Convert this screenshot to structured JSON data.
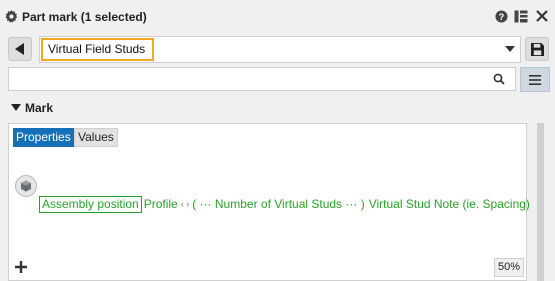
{
  "titlebar": {
    "title": "Part mark (1 selected)",
    "icons": [
      "gear-icon",
      "help-icon",
      "layout-toggle-icon",
      "close-icon"
    ]
  },
  "preset": {
    "value": "Virtual Field Studs",
    "highlight_color": "#f5a623"
  },
  "search": {
    "placeholder": ""
  },
  "mark_section": {
    "heading": "Mark",
    "tabs": [
      {
        "label": "Properties",
        "active": true
      },
      {
        "label": "Values",
        "active": false
      }
    ],
    "elements": [
      {
        "text": "Assembly position",
        "highlighted": true
      },
      {
        "text": "Profile",
        "highlighted": false
      },
      {
        "text": "( ··· Number of Virtual Studs ··· )",
        "highlighted": false
      },
      {
        "text": "Virtual Stud Note (ie. Spacing)",
        "highlighted": false
      }
    ],
    "separator": "‹ ›",
    "element_color": "#2aa12a",
    "zoom": "50%"
  },
  "accent_color": "#1570b7"
}
